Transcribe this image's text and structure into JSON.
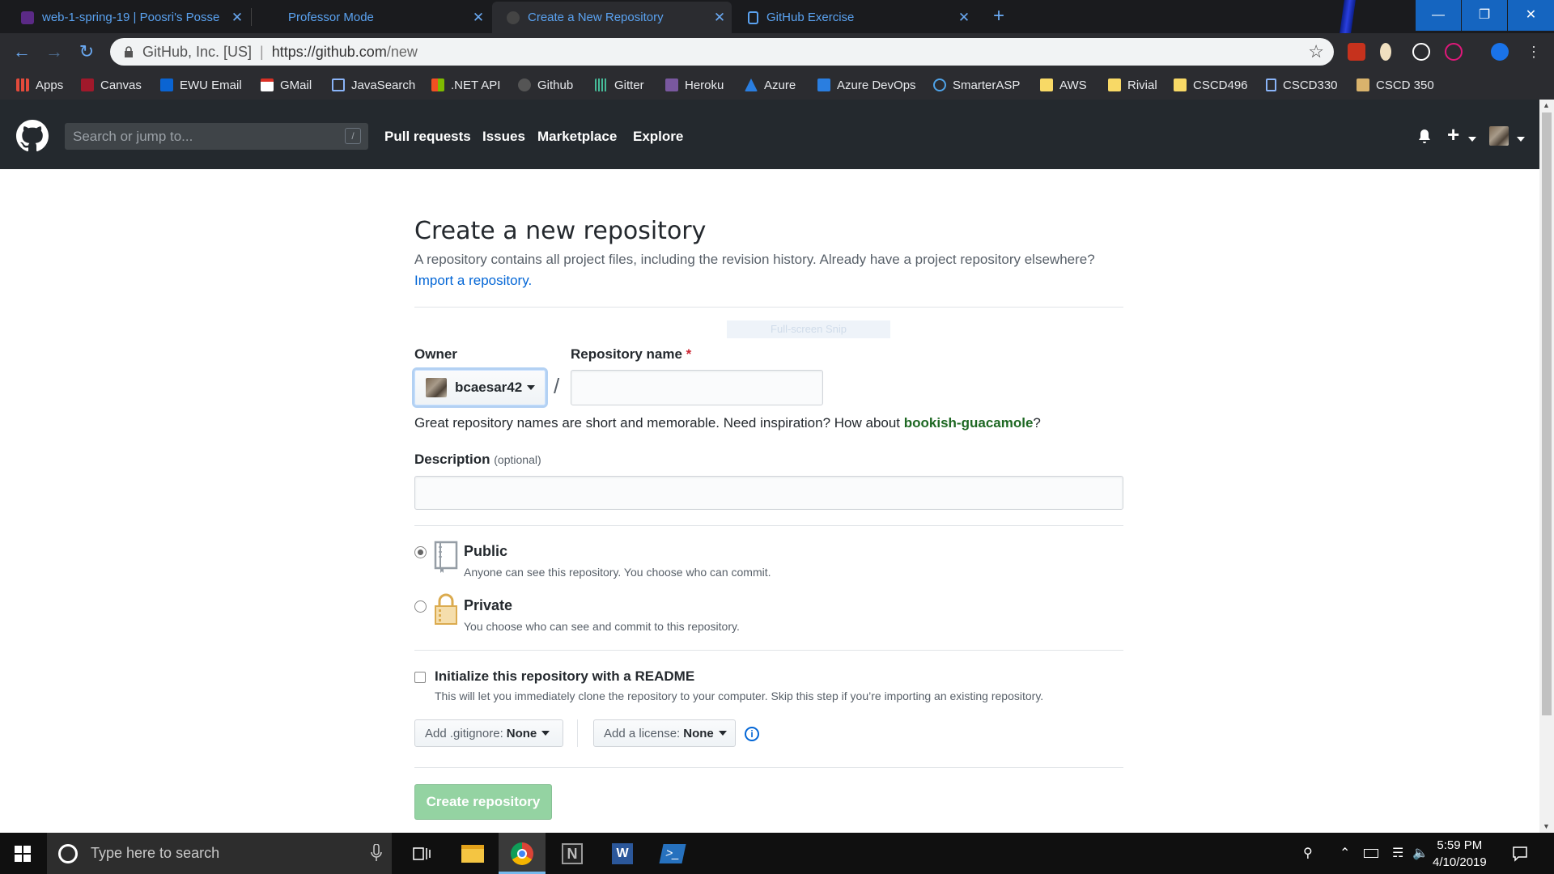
{
  "browser": {
    "tabs": [
      {
        "title": "web-1-spring-19 | Poosri's Posse",
        "close": "✕"
      },
      {
        "title": "Professor Mode",
        "close": "✕"
      },
      {
        "title": "Create a New Repository",
        "close": "✕"
      },
      {
        "title": "GitHub Exercise",
        "close": "✕"
      }
    ],
    "new_tab": "+",
    "window_controls": {
      "minimize": "—",
      "restore": "❐",
      "close": "✕"
    },
    "omnibox": {
      "site_identity": "GitHub, Inc. [US]",
      "separator": "|",
      "url_host": "https://github.com",
      "url_path": "/new"
    },
    "bookmarks": [
      "Apps",
      "Canvas",
      "EWU Email",
      "GMail",
      "JavaSearch",
      ".NET API",
      "Github",
      "Gitter",
      "Heroku",
      "Azure",
      "Azure DevOps",
      "SmarterASP",
      "AWS",
      "Rivial",
      "CSCD496",
      "CSCD330",
      "CSCD 350"
    ]
  },
  "github_header": {
    "search_placeholder": "Search or jump to...",
    "search_shortcut": "/",
    "nav": [
      "Pull requests",
      "Issues",
      "Marketplace",
      "Explore"
    ],
    "plus": "+"
  },
  "page": {
    "title": "Create a new repository",
    "subtitle": "A repository contains all project files, including the revision history. Already have a project repository elsewhere?",
    "import_link": "Import a repository.",
    "snip_overlay": "Full-screen Snip",
    "owner_label": "Owner",
    "owner_value": "bcaesar42",
    "slash": "/",
    "repo_name_label": "Repository name",
    "required_mark": "*",
    "repo_name_value": "",
    "name_hint_prefix": "Great repository names are short and memorable. Need inspiration? How about ",
    "name_suggestion": "bookish-guacamole",
    "name_hint_suffix": "?",
    "description_label": "Description",
    "description_optional": "(optional)",
    "description_value": "",
    "visibility": [
      {
        "title": "Public",
        "desc": "Anyone can see this repository. You choose who can commit.",
        "checked": true
      },
      {
        "title": "Private",
        "desc": "You choose who can see and commit to this repository.",
        "checked": false
      }
    ],
    "readme_label": "Initialize this repository with a README",
    "readme_desc": "This will let you immediately clone the repository to your computer. Skip this step if you’re importing an existing repository.",
    "gitignore_label": "Add .gitignore:",
    "gitignore_value": "None",
    "license_label": "Add a license:",
    "license_value": "None",
    "info_icon": "i",
    "create_button": "Create repository"
  },
  "taskbar": {
    "search_placeholder": "Type here to search",
    "time": "5:59 PM",
    "date": "4/10/2019"
  },
  "colors": {
    "github_header": "#24292e",
    "link": "#0366d6",
    "create_button_disabled": "#94d3a2",
    "suggestion": "#1e6823"
  }
}
